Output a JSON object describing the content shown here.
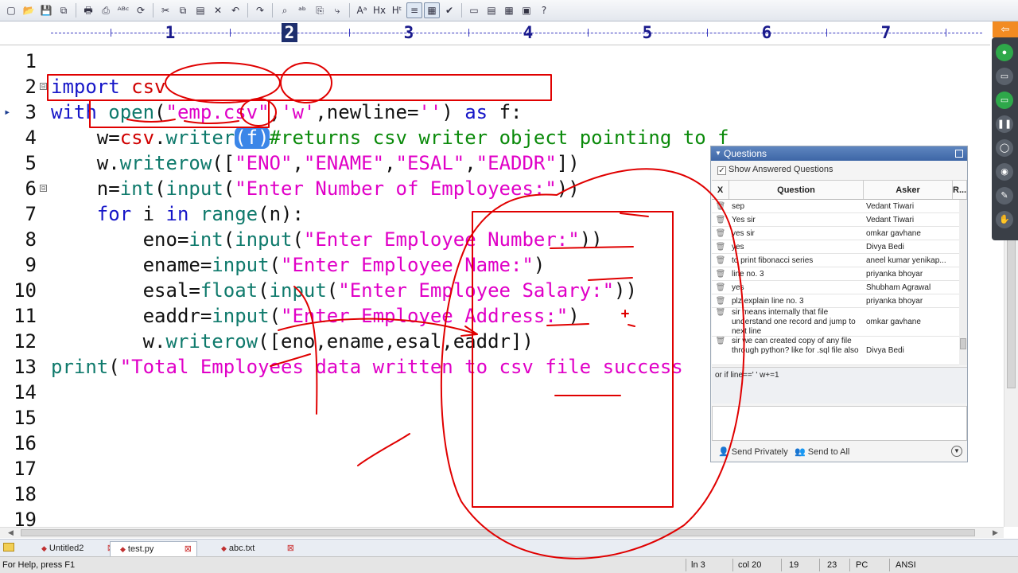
{
  "toolbar": {
    "icons": [
      "new-file-icon",
      "open-folder-icon",
      "save-icon",
      "save-all-icon",
      "print-icon",
      "print-preview-icon",
      "spellcheck-icon",
      "refresh-icon",
      "cut-icon",
      "copy-icon",
      "paste-icon",
      "delete-icon",
      "undo-icon",
      "redo-icon",
      "find-icon",
      "replace-icon",
      "find-in-files-icon",
      "goto-icon",
      "font-icon",
      "hex-icon",
      "html-icon",
      "word-wrap-icon",
      "column-mode-icon",
      "check-icon",
      "window-icon",
      "tile-icon",
      "list-icon",
      "fullscreen-icon",
      "help-icon"
    ],
    "glyphs": [
      "▢",
      "📂",
      "💾",
      "⧉",
      "🖶",
      "⎙",
      "ᴬᴮᶜ",
      "⟳",
      "✂",
      "⧉",
      "▤",
      "✕",
      "↶",
      "↷",
      "⌕",
      "ᵃᵇ",
      "⎘",
      "⤷",
      "Aᵃ",
      "Hx",
      "Hᵗ",
      "≡",
      "▦",
      "✔",
      "▭",
      "▤",
      "▦",
      "▣",
      "?"
    ]
  },
  "ruler": {
    "numbers": [
      "1",
      "2",
      "3",
      "4",
      "5",
      "6",
      "7"
    ],
    "current": "2",
    "corner_icon": "arrow-left-icon"
  },
  "editor": {
    "lines": [
      {
        "num": "1",
        "fold": "",
        "marker": ""
      },
      {
        "num": "2",
        "fold": "⊟",
        "marker": ""
      },
      {
        "num": "3",
        "fold": "",
        "marker": "▸"
      },
      {
        "num": "4",
        "fold": "",
        "marker": ""
      },
      {
        "num": "5",
        "fold": "",
        "marker": ""
      },
      {
        "num": "6",
        "fold": "⊟",
        "marker": ""
      },
      {
        "num": "7",
        "fold": "",
        "marker": ""
      },
      {
        "num": "8",
        "fold": "",
        "marker": ""
      },
      {
        "num": "9",
        "fold": "",
        "marker": ""
      },
      {
        "num": "10",
        "fold": "",
        "marker": ""
      },
      {
        "num": "11",
        "fold": "",
        "marker": ""
      },
      {
        "num": "12",
        "fold": "",
        "marker": ""
      },
      {
        "num": "13",
        "fold": "",
        "marker": ""
      },
      {
        "num": "14",
        "fold": "",
        "marker": ""
      },
      {
        "num": "15",
        "fold": "",
        "marker": ""
      },
      {
        "num": "16",
        "fold": "",
        "marker": ""
      },
      {
        "num": "17",
        "fold": "",
        "marker": ""
      },
      {
        "num": "18",
        "fold": "",
        "marker": ""
      },
      {
        "num": "19",
        "fold": "",
        "marker": ""
      }
    ],
    "code": {
      "l1": {
        "kw": "import",
        "sp": " ",
        "mod": "csv"
      },
      "l2": {
        "kw1": "with",
        "sp1": " ",
        "fn": "open",
        "p1": "(",
        "s1": "\"emp.csv\"",
        "c1": ",",
        "s2": "'w'",
        "c2": ",newline=",
        "s3": "''",
        "p2": ")",
        "sp2": " ",
        "kw2": "as",
        "tail": " f:"
      },
      "l3": {
        "indent": "    ",
        "a": "w=",
        "mod": "csv",
        "b": ".",
        "fn": "writer",
        "c": "(f)",
        "cm": "#returns csv writer object pointing to f"
      },
      "l4": {
        "indent": "    ",
        "a": "w.",
        "fn": "writerow",
        "b": "([",
        "s1": "\"ENO\"",
        "c1": ",",
        "s2": "\"ENAME\"",
        "c2": ",",
        "s3": "\"ESAL\"",
        "c3": ",",
        "s4": "\"EADDR\"",
        "e": "])"
      },
      "l5": {
        "indent": "    ",
        "a": "n=",
        "f1": "int",
        "b": "(",
        "f2": "input",
        "c": "(",
        "s": "\"Enter Number of Employees:\"",
        "e": "))"
      },
      "l6": {
        "indent": "    ",
        "kw1": "for",
        "a": " i ",
        "kw2": "in",
        "sp": " ",
        "fn": "range",
        "e": "(n):"
      },
      "l7": {
        "indent": "        ",
        "a": "eno=",
        "f1": "int",
        "b": "(",
        "f2": "input",
        "c": "(",
        "s": "\"Enter Employee Number:\"",
        "e": "))"
      },
      "l8": {
        "indent": "        ",
        "a": "ename=",
        "f1": "input",
        "b": "(",
        "s": "\"Enter Employee Name:\"",
        "e": ")"
      },
      "l9": {
        "indent": "        ",
        "a": "esal=",
        "f1": "float",
        "b": "(",
        "f2": "input",
        "c": "(",
        "s": "\"Enter Employee Salary:\"",
        "e": "))"
      },
      "l10": {
        "indent": "        ",
        "a": "eaddr=",
        "f1": "input",
        "b": "(",
        "s": "\"Enter Employee Address:\"",
        "e": ")"
      },
      "l11": {
        "indent": "        ",
        "a": "w.",
        "fn": "writerow",
        "e": "([eno,ename,esal,eaddr])"
      },
      "l12": {
        "fn": "print",
        "a": "(",
        "s": "\"Total Employees data written to csv file success"
      }
    }
  },
  "tabs": [
    {
      "label": "Untitled2",
      "active": false
    },
    {
      "label": "test.py",
      "active": true
    },
    {
      "label": "abc.txt",
      "active": false
    }
  ],
  "status": {
    "help": "For Help, press F1",
    "line": "ln 3",
    "col": "col 20",
    "v1": "19",
    "v2": "23",
    "eol": "PC",
    "encoding": "ANSI"
  },
  "questions": {
    "title": "Questions",
    "show_answered": "Show Answered Questions",
    "columns": [
      "X",
      "Question",
      "Asker",
      "R..."
    ],
    "rows": [
      {
        "q": "sep",
        "asker": "Vedant Tiwari"
      },
      {
        "q": "Yes sir",
        "asker": "Vedant Tiwari"
      },
      {
        "q": "yes sir",
        "asker": "omkar gavhane"
      },
      {
        "q": "yes",
        "asker": "Divya Bedi"
      },
      {
        "q": "to print fibonacci series",
        "asker": "aneel kumar yenikap..."
      },
      {
        "q": "line no. 3",
        "asker": "priyanka bhoyar"
      },
      {
        "q": "yes",
        "asker": "Shubham Agrawal"
      },
      {
        "q": "plz explain line no. 3",
        "asker": "priyanka bhoyar"
      },
      {
        "q": "sir means internally that file understand one record and jump to next line",
        "asker": "omkar gavhane"
      },
      {
        "q": "sir we can created copy of any file through python? like for .sql file also",
        "asker": "Divya Bedi"
      }
    ],
    "answer_text": "or if line==' ' w+=1",
    "send_privately": "Send Privately",
    "send_all": "Send to All"
  },
  "sidepanel": {
    "icons": [
      "mic-icon",
      "camera-icon",
      "screen-share-icon",
      "pause-icon",
      "mouse-icon",
      "camera-alt-icon",
      "pen-icon",
      "hand-icon"
    ],
    "glyphs": [
      "●",
      "▭",
      "▭",
      "❚❚",
      "◯",
      "◉",
      "✎",
      "✋"
    ]
  },
  "colors": {
    "keyword": "#1616c8",
    "builtin": "#0f7a6c",
    "string": "#e000c7",
    "comment": "#0a8a0a",
    "module": "#d00000",
    "annotation": "#e00000"
  }
}
